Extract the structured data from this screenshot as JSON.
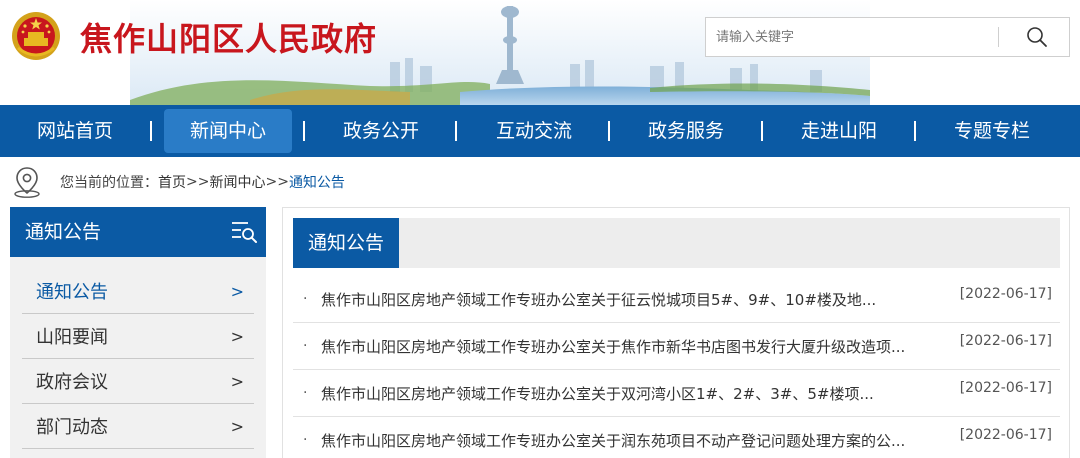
{
  "header": {
    "site_title": "焦作山阳区人民政府",
    "emblem_icon": "national-emblem-icon",
    "search": {
      "placeholder": "请输入关键字",
      "value": "",
      "button_icon": "search-icon"
    }
  },
  "nav": {
    "items": [
      {
        "label": "网站首页",
        "active": false
      },
      {
        "label": "新闻中心",
        "active": true
      },
      {
        "label": "政务公开",
        "active": false
      },
      {
        "label": "互动交流",
        "active": false
      },
      {
        "label": "政务服务",
        "active": false
      },
      {
        "label": "走进山阳",
        "active": false
      },
      {
        "label": "专题专栏",
        "active": false
      }
    ]
  },
  "breadcrumb": {
    "icon": "location-pin-icon",
    "prefix": "您当前的位置：",
    "items": [
      "首页",
      "新闻中心",
      "通知公告"
    ],
    "separator": ">>"
  },
  "sidebar": {
    "title": "通知公告",
    "menu_icon": "list-search-icon",
    "items": [
      {
        "label": "通知公告",
        "arrow": ">",
        "active": true
      },
      {
        "label": "山阳要闻",
        "arrow": ">",
        "active": false
      },
      {
        "label": "政府会议",
        "arrow": ">",
        "active": false
      },
      {
        "label": "部门动态",
        "arrow": ">",
        "active": false
      }
    ]
  },
  "main": {
    "tab_label": "通知公告",
    "bullet": "·",
    "news": [
      {
        "title": "焦作市山阳区房地产领域工作专班办公室关于征云悦城项目5#、9#、10#楼及地...",
        "date": "[2022-06-17]"
      },
      {
        "title": "焦作市山阳区房地产领域工作专班办公室关于焦作市新华书店图书发行大厦升级改造项...",
        "date": "[2022-06-17]"
      },
      {
        "title": "焦作市山阳区房地产领域工作专班办公室关于双河湾小区1#、2#、3#、5#楼项...",
        "date": "[2022-06-17]"
      },
      {
        "title": "焦作市山阳区房地产领域工作专班办公室关于润东苑项目不动产登记问题处理方案的公...",
        "date": "[2022-06-17]"
      }
    ]
  },
  "colors": {
    "brand_blue": "#0b5aa4",
    "nav_active": "#2a7cc7",
    "title_red": "#c8161d",
    "sidebar_bg": "#f1f1f1"
  }
}
